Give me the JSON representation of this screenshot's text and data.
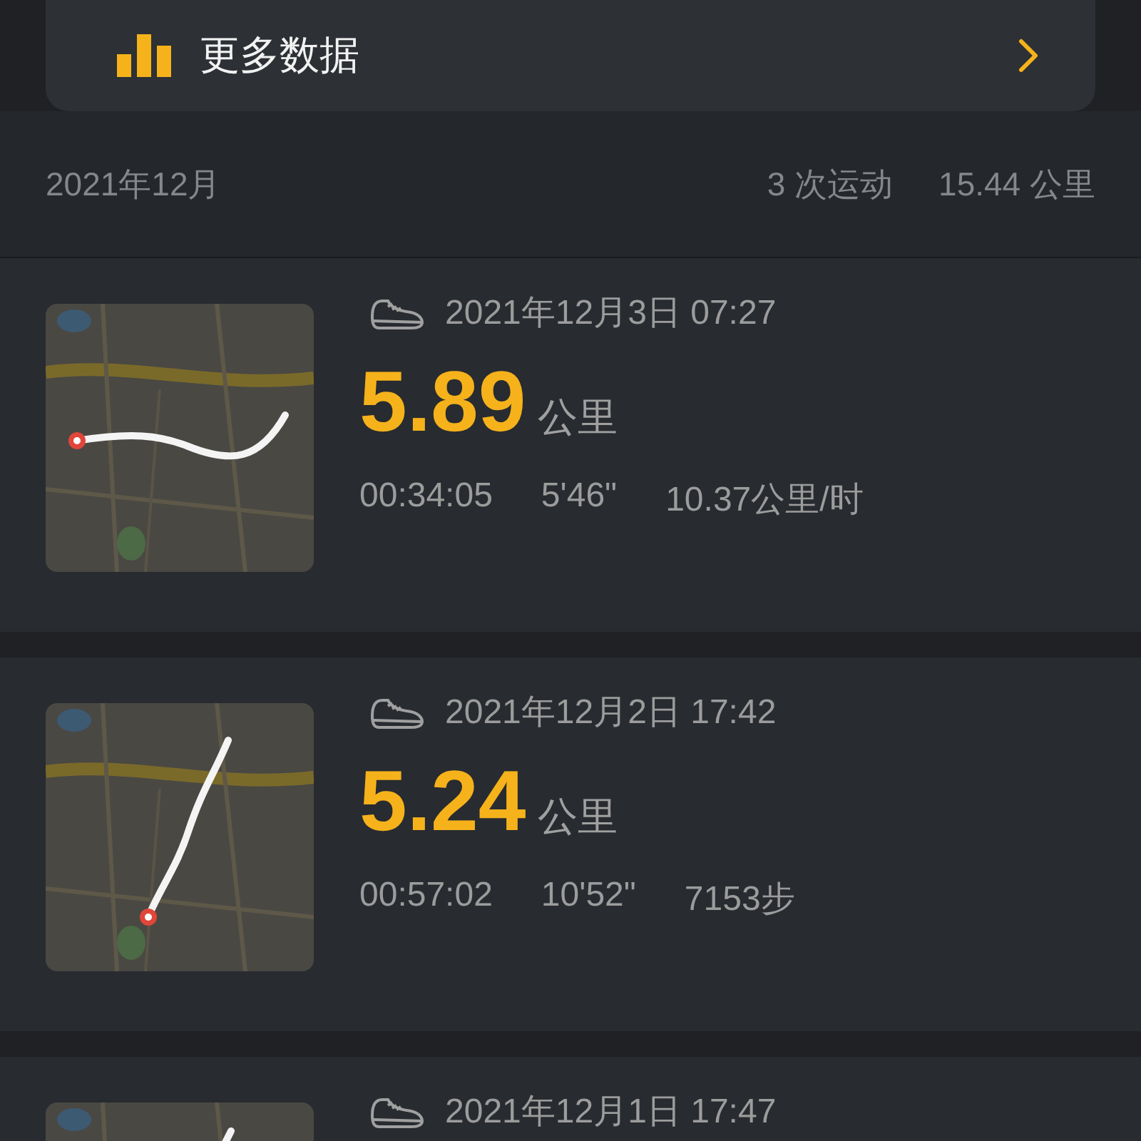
{
  "more_data": {
    "label": "更多数据"
  },
  "month_header": {
    "month": "2021年12月",
    "count": "3 次运动",
    "distance": "15.44 公里"
  },
  "activities": [
    {
      "kind": "picture",
      "datetime": "2021年12月3日 07:27",
      "distance": "5.89",
      "unit": "公里",
      "stats": [
        "00:34:05",
        "5'46\"",
        "10.37公里/时"
      ]
    },
    {
      "kind": "picture",
      "datetime": "2021年12月2日 17:42",
      "distance": "5.24",
      "unit": "公里",
      "stats": [
        "00:57:02",
        "10'52\"",
        "7153步"
      ]
    },
    {
      "kind": "picture",
      "datetime": "2021年12月1日 17:47"
    }
  ]
}
